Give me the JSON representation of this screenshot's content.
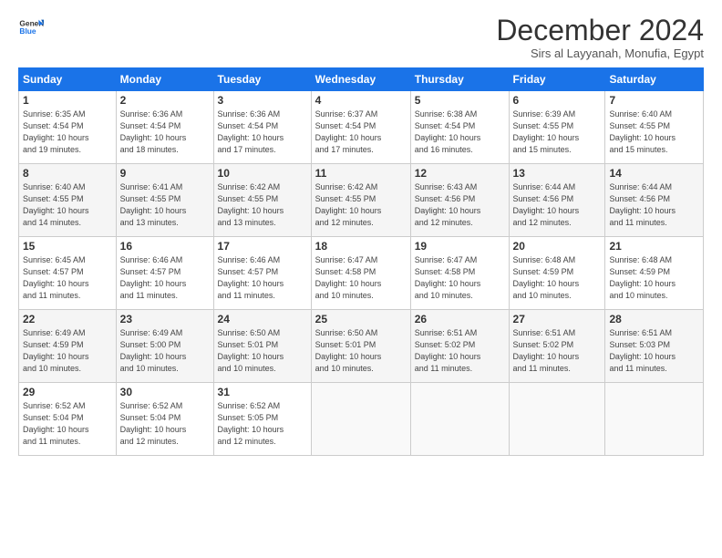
{
  "logo": {
    "line1": "General",
    "line2": "Blue"
  },
  "title": "December 2024",
  "subtitle": "Sirs al Layyanah, Monufia, Egypt",
  "headers": [
    "Sunday",
    "Monday",
    "Tuesday",
    "Wednesday",
    "Thursday",
    "Friday",
    "Saturday"
  ],
  "weeks": [
    [
      {
        "day": "1",
        "info": "Sunrise: 6:35 AM\nSunset: 4:54 PM\nDaylight: 10 hours\nand 19 minutes."
      },
      {
        "day": "2",
        "info": "Sunrise: 6:36 AM\nSunset: 4:54 PM\nDaylight: 10 hours\nand 18 minutes."
      },
      {
        "day": "3",
        "info": "Sunrise: 6:36 AM\nSunset: 4:54 PM\nDaylight: 10 hours\nand 17 minutes."
      },
      {
        "day": "4",
        "info": "Sunrise: 6:37 AM\nSunset: 4:54 PM\nDaylight: 10 hours\nand 17 minutes."
      },
      {
        "day": "5",
        "info": "Sunrise: 6:38 AM\nSunset: 4:54 PM\nDaylight: 10 hours\nand 16 minutes."
      },
      {
        "day": "6",
        "info": "Sunrise: 6:39 AM\nSunset: 4:55 PM\nDaylight: 10 hours\nand 15 minutes."
      },
      {
        "day": "7",
        "info": "Sunrise: 6:40 AM\nSunset: 4:55 PM\nDaylight: 10 hours\nand 15 minutes."
      }
    ],
    [
      {
        "day": "8",
        "info": "Sunrise: 6:40 AM\nSunset: 4:55 PM\nDaylight: 10 hours\nand 14 minutes."
      },
      {
        "day": "9",
        "info": "Sunrise: 6:41 AM\nSunset: 4:55 PM\nDaylight: 10 hours\nand 13 minutes."
      },
      {
        "day": "10",
        "info": "Sunrise: 6:42 AM\nSunset: 4:55 PM\nDaylight: 10 hours\nand 13 minutes."
      },
      {
        "day": "11",
        "info": "Sunrise: 6:42 AM\nSunset: 4:55 PM\nDaylight: 10 hours\nand 12 minutes."
      },
      {
        "day": "12",
        "info": "Sunrise: 6:43 AM\nSunset: 4:56 PM\nDaylight: 10 hours\nand 12 minutes."
      },
      {
        "day": "13",
        "info": "Sunrise: 6:44 AM\nSunset: 4:56 PM\nDaylight: 10 hours\nand 12 minutes."
      },
      {
        "day": "14",
        "info": "Sunrise: 6:44 AM\nSunset: 4:56 PM\nDaylight: 10 hours\nand 11 minutes."
      }
    ],
    [
      {
        "day": "15",
        "info": "Sunrise: 6:45 AM\nSunset: 4:57 PM\nDaylight: 10 hours\nand 11 minutes."
      },
      {
        "day": "16",
        "info": "Sunrise: 6:46 AM\nSunset: 4:57 PM\nDaylight: 10 hours\nand 11 minutes."
      },
      {
        "day": "17",
        "info": "Sunrise: 6:46 AM\nSunset: 4:57 PM\nDaylight: 10 hours\nand 11 minutes."
      },
      {
        "day": "18",
        "info": "Sunrise: 6:47 AM\nSunset: 4:58 PM\nDaylight: 10 hours\nand 10 minutes."
      },
      {
        "day": "19",
        "info": "Sunrise: 6:47 AM\nSunset: 4:58 PM\nDaylight: 10 hours\nand 10 minutes."
      },
      {
        "day": "20",
        "info": "Sunrise: 6:48 AM\nSunset: 4:59 PM\nDaylight: 10 hours\nand 10 minutes."
      },
      {
        "day": "21",
        "info": "Sunrise: 6:48 AM\nSunset: 4:59 PM\nDaylight: 10 hours\nand 10 minutes."
      }
    ],
    [
      {
        "day": "22",
        "info": "Sunrise: 6:49 AM\nSunset: 4:59 PM\nDaylight: 10 hours\nand 10 minutes."
      },
      {
        "day": "23",
        "info": "Sunrise: 6:49 AM\nSunset: 5:00 PM\nDaylight: 10 hours\nand 10 minutes."
      },
      {
        "day": "24",
        "info": "Sunrise: 6:50 AM\nSunset: 5:01 PM\nDaylight: 10 hours\nand 10 minutes."
      },
      {
        "day": "25",
        "info": "Sunrise: 6:50 AM\nSunset: 5:01 PM\nDaylight: 10 hours\nand 10 minutes."
      },
      {
        "day": "26",
        "info": "Sunrise: 6:51 AM\nSunset: 5:02 PM\nDaylight: 10 hours\nand 11 minutes."
      },
      {
        "day": "27",
        "info": "Sunrise: 6:51 AM\nSunset: 5:02 PM\nDaylight: 10 hours\nand 11 minutes."
      },
      {
        "day": "28",
        "info": "Sunrise: 6:51 AM\nSunset: 5:03 PM\nDaylight: 10 hours\nand 11 minutes."
      }
    ],
    [
      {
        "day": "29",
        "info": "Sunrise: 6:52 AM\nSunset: 5:04 PM\nDaylight: 10 hours\nand 11 minutes."
      },
      {
        "day": "30",
        "info": "Sunrise: 6:52 AM\nSunset: 5:04 PM\nDaylight: 10 hours\nand 12 minutes."
      },
      {
        "day": "31",
        "info": "Sunrise: 6:52 AM\nSunset: 5:05 PM\nDaylight: 10 hours\nand 12 minutes."
      },
      null,
      null,
      null,
      null
    ]
  ]
}
